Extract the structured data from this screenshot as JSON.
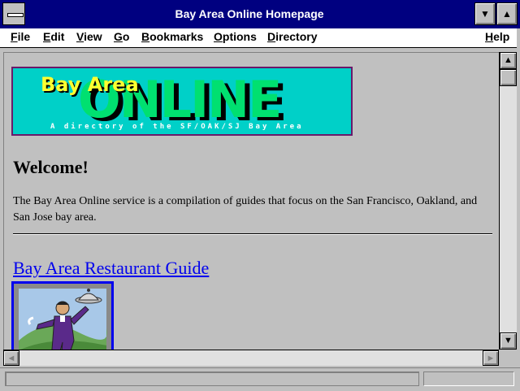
{
  "window": {
    "title": "Bay Area Online Homepage",
    "sysmenu_icon": "system-menu-icon",
    "minimize_glyph": "▼",
    "maximize_glyph": "▲"
  },
  "menubar": {
    "items": [
      {
        "accel": "F",
        "rest": "ile"
      },
      {
        "accel": "E",
        "rest": "dit"
      },
      {
        "accel": "V",
        "rest": "iew"
      },
      {
        "accel": "G",
        "rest": "o"
      },
      {
        "accel": "B",
        "rest": "ookmarks"
      },
      {
        "accel": "O",
        "rest": "ptions"
      },
      {
        "accel": "D",
        "rest": "irectory"
      },
      {
        "accel": "H",
        "rest": "elp"
      }
    ]
  },
  "page": {
    "logo": {
      "bay_area": "Bay Area",
      "online": "ONLINE",
      "tagline": "A directory of the SF/OAK/SJ Bay Area",
      "colors": {
        "background": "#00d0c8",
        "online": "#00e070",
        "bay_area": "#ffff30",
        "border": "#6a1a6a"
      }
    },
    "heading": "Welcome!",
    "intro": "The Bay Area Online service is a compilation of guides that focus on the San Francisco, Oakland, and San Jose bay area.",
    "restaurant_guide_link": "Bay Area Restaurant Guide",
    "link_color": "#0000ee"
  },
  "scrollbars": {
    "up_glyph": "▲",
    "down_glyph": "▼",
    "left_glyph": "◄",
    "right_glyph": "►"
  },
  "statusbar": {
    "text": ""
  }
}
